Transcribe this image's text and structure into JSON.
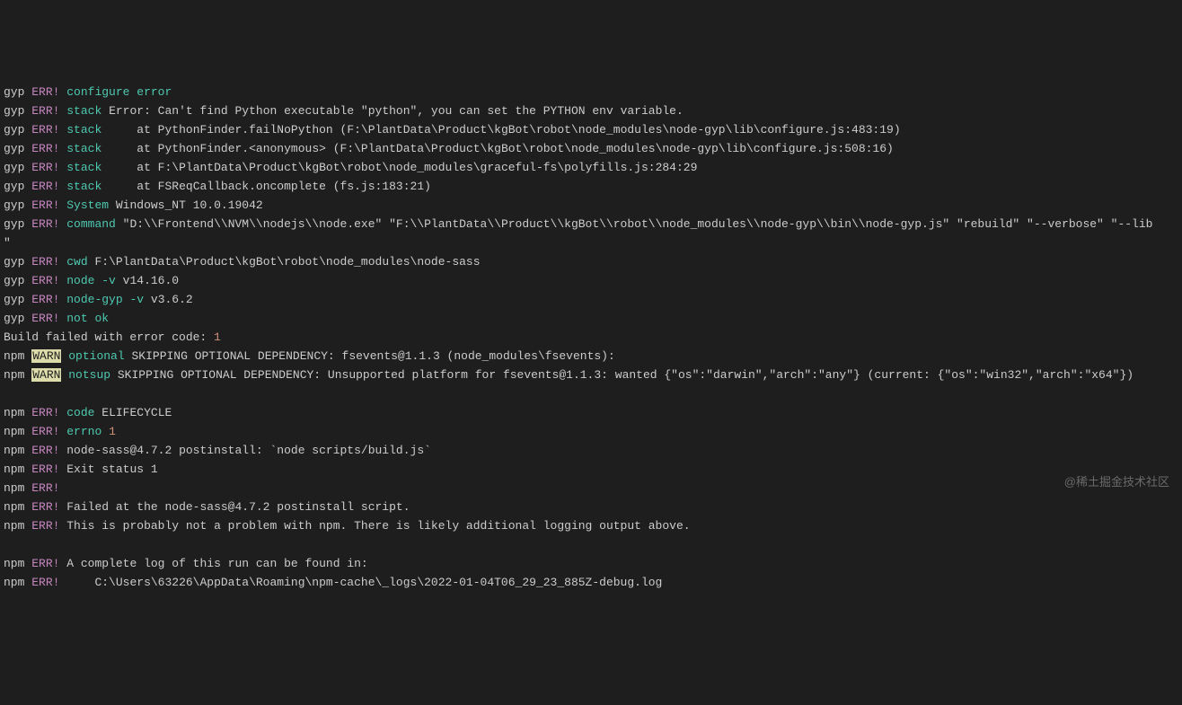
{
  "lines": [
    {
      "prefix": "gyp",
      "level": "ERR!",
      "tag": "configure error",
      "msg": ""
    },
    {
      "prefix": "gyp",
      "level": "ERR!",
      "tag": "stack",
      "msg": "Error: Can't find Python executable \"python\", you can set the PYTHON env variable."
    },
    {
      "prefix": "gyp",
      "level": "ERR!",
      "tag": "stack",
      "msg": "    at PythonFinder.failNoPython (F:\\PlantData\\Product\\kgBot\\robot\\node_modules\\node-gyp\\lib\\configure.js:483:19)"
    },
    {
      "prefix": "gyp",
      "level": "ERR!",
      "tag": "stack",
      "msg": "    at PythonFinder.<anonymous> (F:\\PlantData\\Product\\kgBot\\robot\\node_modules\\node-gyp\\lib\\configure.js:508:16)"
    },
    {
      "prefix": "gyp",
      "level": "ERR!",
      "tag": "stack",
      "msg": "    at F:\\PlantData\\Product\\kgBot\\robot\\node_modules\\graceful-fs\\polyfills.js:284:29"
    },
    {
      "prefix": "gyp",
      "level": "ERR!",
      "tag": "stack",
      "msg": "    at FSReqCallback.oncomplete (fs.js:183:21)"
    },
    {
      "prefix": "gyp",
      "level": "ERR!",
      "tag": "System",
      "msg": "Windows_NT 10.0.19042"
    },
    {
      "prefix": "gyp",
      "level": "ERR!",
      "tag": "command",
      "msg": "\"D:\\\\Frontend\\\\NVM\\\\nodejs\\\\node.exe\" \"F:\\\\PlantData\\\\Product\\\\kgBot\\\\robot\\\\node_modules\\\\node-gyp\\\\bin\\\\node-gyp.js\" \"rebuild\" \"--verbose\" \"--lib"
    },
    {
      "wrap": true,
      "msg": "\""
    },
    {
      "prefix": "gyp",
      "level": "ERR!",
      "tag": "cwd",
      "msg": "F:\\PlantData\\Product\\kgBot\\robot\\node_modules\\node-sass"
    },
    {
      "prefix": "gyp",
      "level": "ERR!",
      "tag": "node -v",
      "msg": "v14.16.0"
    },
    {
      "prefix": "gyp",
      "level": "ERR!",
      "tag": "node-gyp -v",
      "msg": "v3.6.2"
    },
    {
      "prefix": "gyp",
      "level": "ERR!",
      "tag": "not ok",
      "msg": ""
    },
    {
      "plain": true,
      "msgPre": "Build failed with error code: ",
      "num": "1"
    },
    {
      "prefix": "npm",
      "warn": "WARN",
      "tag": "optional",
      "msg": "SKIPPING OPTIONAL DEPENDENCY: fsevents@1.1.3 (node_modules\\fsevents):"
    },
    {
      "prefix": "npm",
      "warn": "WARN",
      "tag": "notsup",
      "msg": "SKIPPING OPTIONAL DEPENDENCY: Unsupported platform for fsevents@1.1.3: wanted {\"os\":\"darwin\",\"arch\":\"any\"} (current: {\"os\":\"win32\",\"arch\":\"x64\"})"
    },
    {
      "blank": true
    },
    {
      "prefix": "npm",
      "level": "ERR!",
      "tag": "code",
      "msg": "ELIFECYCLE"
    },
    {
      "prefix": "npm",
      "level": "ERR!",
      "tag": "errno",
      "num": "1"
    },
    {
      "prefix": "npm",
      "level": "ERR!",
      "msg": "node-sass@4.7.2 postinstall: `node scripts/build.js`"
    },
    {
      "prefix": "npm",
      "level": "ERR!",
      "msg": "Exit status 1"
    },
    {
      "prefix": "npm",
      "level": "ERR!",
      "msg": ""
    },
    {
      "prefix": "npm",
      "level": "ERR!",
      "msg": "Failed at the node-sass@4.7.2 postinstall script."
    },
    {
      "prefix": "npm",
      "level": "ERR!",
      "msg": "This is probably not a problem with npm. There is likely additional logging output above."
    },
    {
      "blank": true
    },
    {
      "prefix": "npm",
      "level": "ERR!",
      "msg": "A complete log of this run can be found in:"
    },
    {
      "prefix": "npm",
      "level": "ERR!",
      "msg": "    C:\\Users\\63226\\AppData\\Roaming\\npm-cache\\_logs\\2022-01-04T06_29_23_885Z-debug.log"
    }
  ],
  "watermark": "@稀土掘金技术社区"
}
